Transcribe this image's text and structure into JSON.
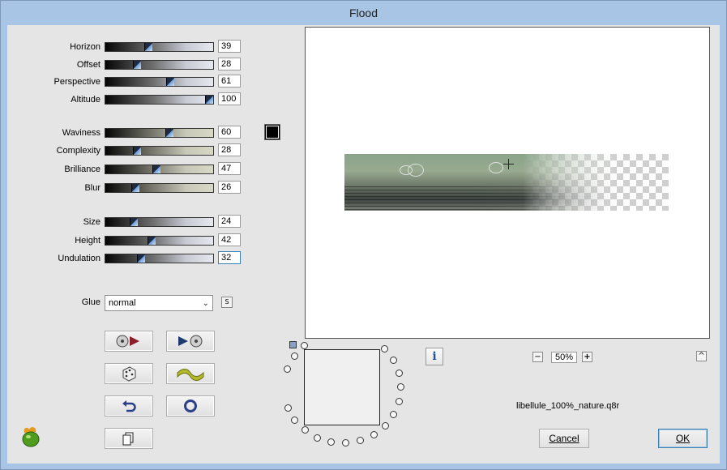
{
  "window": {
    "title": "Flood"
  },
  "group1": [
    {
      "label": "Horizon",
      "value": "39",
      "fill": 39,
      "tone": "gray"
    },
    {
      "label": "Offset",
      "value": "28",
      "fill": 28,
      "tone": "gray"
    },
    {
      "label": "Perspective",
      "value": "61",
      "fill": 61,
      "tone": "gray"
    },
    {
      "label": "Altitude",
      "value": "100",
      "fill": 100,
      "tone": "gray"
    }
  ],
  "group2": [
    {
      "label": "Waviness",
      "value": "60",
      "fill": 60,
      "tone": "olive"
    },
    {
      "label": "Complexity",
      "value": "28",
      "fill": 28,
      "tone": "olive"
    },
    {
      "label": "Brilliance",
      "value": "47",
      "fill": 47,
      "tone": "olive"
    },
    {
      "label": "Blur",
      "value": "26",
      "fill": 26,
      "tone": "olive"
    }
  ],
  "group3": [
    {
      "label": "Size",
      "value": "24",
      "fill": 24,
      "tone": "gray"
    },
    {
      "label": "Height",
      "value": "42",
      "fill": 42,
      "tone": "gray"
    },
    {
      "label": "Undulation",
      "value": "32",
      "fill": 32,
      "tone": "gray"
    }
  ],
  "color": {
    "swatch": "#000000"
  },
  "glue": {
    "label": "Glue",
    "value": "normal",
    "s_button": "S"
  },
  "tools": [
    "load-preset-icon",
    "save-preset-icon",
    "random-dice-icon",
    "wave-icon",
    "undo-icon",
    "reset-icon",
    "copy-icon"
  ],
  "zoom": {
    "value": "50%",
    "minus": "−",
    "plus": "+"
  },
  "info_label": "i",
  "collapse_label": "^",
  "preset_name": "libellule_100%_nature.q8r",
  "buttons": {
    "cancel": "Cancel",
    "ok": "OK"
  }
}
